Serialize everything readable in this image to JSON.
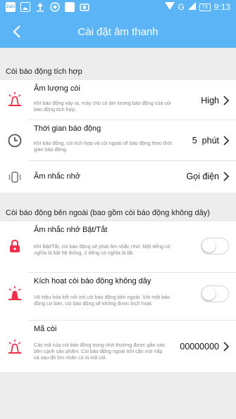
{
  "status_bar": {
    "left_icons": [
      "zalo-icon",
      "gallery-icon",
      "upload-icon",
      "record-icon",
      "square-icon",
      "camera-icon"
    ],
    "zalo_text": "Zalo",
    "network": "G",
    "battery": "73",
    "time": "9:13"
  },
  "header": {
    "title": "Cài đặt âm thanh",
    "background_color": "#5ab4f5"
  },
  "sections": [
    {
      "label": "Còi báo động tích hợp",
      "items": [
        {
          "title": "Âm lượng còi",
          "description": "Khi báo động xảy ra, máy chủ có âm lượng báo động của còi báo động tích hợp.",
          "value": "High",
          "control": "chevron",
          "icon": "siren-icon"
        },
        {
          "title": "Thời gian báo động",
          "description": "Khi báo động, còi tích hợp và còi ngoài sẽ báo động theo thời gian báo động.",
          "value": "5  phút",
          "control": "chevron",
          "icon": "clock-icon"
        },
        {
          "title": "Âm nhắc nhở",
          "description": "",
          "value": "Gọi điện",
          "control": "chevron",
          "icon": "vibrate-icon"
        }
      ]
    },
    {
      "label": "Còi báo động bên ngoài (bao gồm còi báo động không dây)",
      "items": [
        {
          "title": "Âm nhắc nhở Bật/Tắt",
          "description": "Khi Bật/Tắt, còi báo động sẽ phát âm nhắc nhở. Một tiếng có nghĩa là bật hệ thống, 2 tiếng có nghĩa là tắt.",
          "control": "toggle",
          "toggle_on": false,
          "icon": "lock-icon"
        },
        {
          "title": "Kích hoạt còi báo động không dây",
          "description": "Vô hiệu hóa kết nối với còi báo động bên ngoài. Với một báo động cơ bản, còi báo động sẽ không được kích hoạt.",
          "control": "toggle",
          "toggle_on": false,
          "icon": "wireless-siren-icon"
        },
        {
          "title": "Mã còi",
          "description": "Các mã của còi báo động trong nhà thường được gắn vào bên cạnh sản phẩm. Còi báo động ngoài trời cần mở nắp và sau đó tìm nhãn có in mã còi.",
          "value": "00000000",
          "control": "chevron",
          "icon": "siren-icon"
        }
      ]
    }
  ],
  "colors": {
    "accent": "#5ab4f5",
    "alarm_red": "#f0304a",
    "icon_gray": "#555555"
  }
}
